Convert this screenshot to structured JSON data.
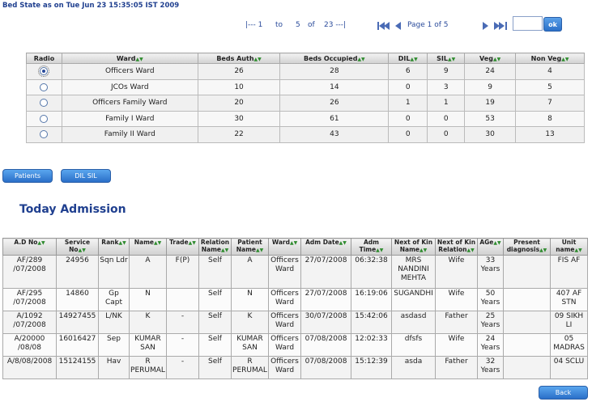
{
  "header": {
    "title": "Bed State as on Tue Jun 23 15:35:05 IST 2009"
  },
  "pager": {
    "start": "|--- 1",
    "to": "to",
    "end": "5",
    "of": "of",
    "total": "23 ---|",
    "page_label": "Page 1 of 5",
    "goto_value": "",
    "ok_label": "ok"
  },
  "ward_table": {
    "headers": [
      "Radio",
      "Ward",
      "Beds Auth",
      "Beds Occupied",
      "DIL",
      "SIL",
      "Veg",
      "Non Veg"
    ],
    "sort_glyph": "▲▼",
    "rows": [
      {
        "selected": true,
        "ward": "Officers Ward",
        "beds_auth": "26",
        "beds_occ": "28",
        "dil": "6",
        "sil": "9",
        "veg": "24",
        "nonveg": "4"
      },
      {
        "selected": false,
        "ward": "JCOs Ward",
        "beds_auth": "10",
        "beds_occ": "14",
        "dil": "0",
        "sil": "3",
        "veg": "9",
        "nonveg": "5"
      },
      {
        "selected": false,
        "ward": "Officers Family Ward",
        "beds_auth": "20",
        "beds_occ": "26",
        "dil": "1",
        "sil": "1",
        "veg": "19",
        "nonveg": "7"
      },
      {
        "selected": false,
        "ward": "Family I Ward",
        "beds_auth": "30",
        "beds_occ": "61",
        "dil": "0",
        "sil": "0",
        "veg": "53",
        "nonveg": "8"
      },
      {
        "selected": false,
        "ward": "Family II Ward",
        "beds_auth": "22",
        "beds_occ": "43",
        "dil": "0",
        "sil": "0",
        "veg": "30",
        "nonveg": "13"
      }
    ]
  },
  "buttons": {
    "patients": "Patients",
    "dil_sil": "DIL SIL",
    "back": "Back"
  },
  "admission": {
    "section_title": "Today Admission",
    "headers": [
      "A.D No",
      "Service No",
      "Rank",
      "Name",
      "Trade",
      "Relation Name",
      "Patient Name",
      "Ward",
      "Adm Date",
      "Adm Time",
      "Next of Kin Name",
      "Next of Kin Relation",
      "AGe",
      "Present diagnosis",
      "Unit name"
    ],
    "rows": [
      {
        "adno": "AF/289 /07/2008",
        "service": "24956",
        "rank": "Sqn Ldr",
        "name": "A",
        "trade": "F(P)",
        "relation": "Self",
        "patient": "A",
        "ward": "Officers Ward",
        "date": "27/07/2008",
        "time": "06:32:38",
        "nok": "MRS NANDINI MEHTA",
        "nok_rel": "Wife",
        "age": "33 Years",
        "diag": "",
        "unit": "FIS AF"
      },
      {
        "adno": "AF/295 /07/2008",
        "service": "14860",
        "rank": "Gp Capt",
        "name": "N",
        "trade": "",
        "relation": "Self",
        "patient": "N",
        "ward": "Officers Ward",
        "date": "27/07/2008",
        "time": "16:19:06",
        "nok": "SUGANDHI",
        "nok_rel": "Wife",
        "age": "50 Years",
        "diag": "",
        "unit": "407 AF STN"
      },
      {
        "adno": "A/1092 /07/2008",
        "service": "14927455",
        "rank": "L/NK",
        "name": "K",
        "trade": "-",
        "relation": "Self",
        "patient": "K",
        "ward": "Officers Ward",
        "date": "30/07/2008",
        "time": "15:42:06",
        "nok": "asdasd",
        "nok_rel": "Father",
        "age": "25 Years",
        "diag": "",
        "unit": "09 SIKH LI"
      },
      {
        "adno": "A/20000 /08/08",
        "service": "16016427",
        "rank": "Sep",
        "name": "KUMAR SAN",
        "trade": "-",
        "relation": "Self",
        "patient": "KUMAR SAN",
        "ward": "Officers Ward",
        "date": "07/08/2008",
        "time": "12:02:33",
        "nok": "dfsfs",
        "nok_rel": "Wife",
        "age": "24 Years",
        "diag": "",
        "unit": "05 MADRAS"
      },
      {
        "adno": "A/8/08/2008",
        "service": "15124155",
        "rank": "Hav",
        "name": "R PERUMAL",
        "trade": "-",
        "relation": "Self",
        "patient": "R PERUMAL",
        "ward": "Officers Ward",
        "date": "07/08/2008",
        "time": "15:12:39",
        "nok": "asda",
        "nok_rel": "Father",
        "age": "32 Years",
        "diag": "",
        "unit": "04 SCLU"
      }
    ]
  }
}
